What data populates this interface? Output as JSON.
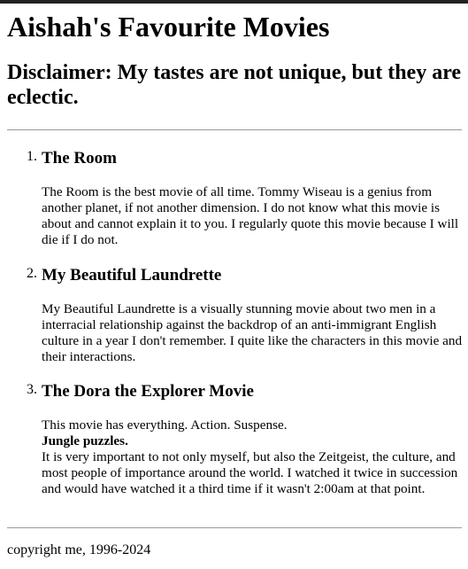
{
  "page": {
    "title": "Aishah's Favourite Movies",
    "subtitle": "Disclaimer: My tastes are not unique, but they are eclectic."
  },
  "movies": [
    {
      "number": "1.",
      "title": "The Room",
      "description": "The Room is the best movie of all time. Tommy Wiseau is a genius from another planet, if not another dimension. I do not know what this movie is about and cannot explain it to you. I regularly quote this movie because I will die if I do not."
    },
    {
      "number": "2.",
      "title": "My Beautiful Laundrette",
      "description": "My Beautiful Laundrette is a visually stunning movie about two men in a interracial relationship against the backdrop of an anti-immigrant English culture in a year I don't remember. I quite like the characters in this movie and their interactions."
    },
    {
      "number": "3.",
      "title": "The Dora the Explorer Movie",
      "description_line1": "This movie has everything. Action. Suspense.",
      "description_bold": "Jungle puzzles.",
      "description_line2": "It is very important to not only myself, but also the Zeitgeist, the culture, and most people of importance around the world. I watched it twice in succession and would have watched it a third time if it wasn't 2:00am at that point."
    }
  ],
  "footer": {
    "text": "copyright me, 1996-2024"
  }
}
